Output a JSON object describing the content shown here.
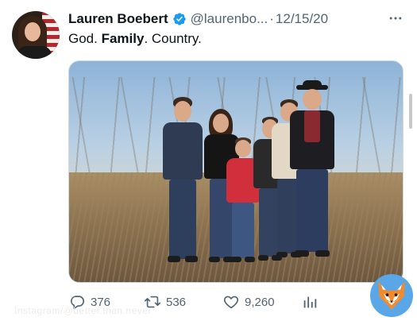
{
  "author": {
    "name": "Lauren Boebert",
    "handle": "@laurenbo...",
    "separator": "·",
    "date": "12/15/20"
  },
  "tweet": {
    "text_parts": [
      "God. ",
      "Family",
      ". Country."
    ]
  },
  "actions": {
    "replies": "376",
    "retweets": "536",
    "likes": "9,260"
  },
  "watermark": "Instagram/@better.than.never",
  "colors": {
    "text": "#0f1419",
    "muted": "#536471",
    "verified": "#1d9bf0",
    "border": "#cfd9de"
  },
  "icons": [
    "verified-badge-icon",
    "more-options-icon",
    "reply-icon",
    "retweet-icon",
    "like-icon",
    "stats-icon",
    "fox-logo-icon"
  ]
}
